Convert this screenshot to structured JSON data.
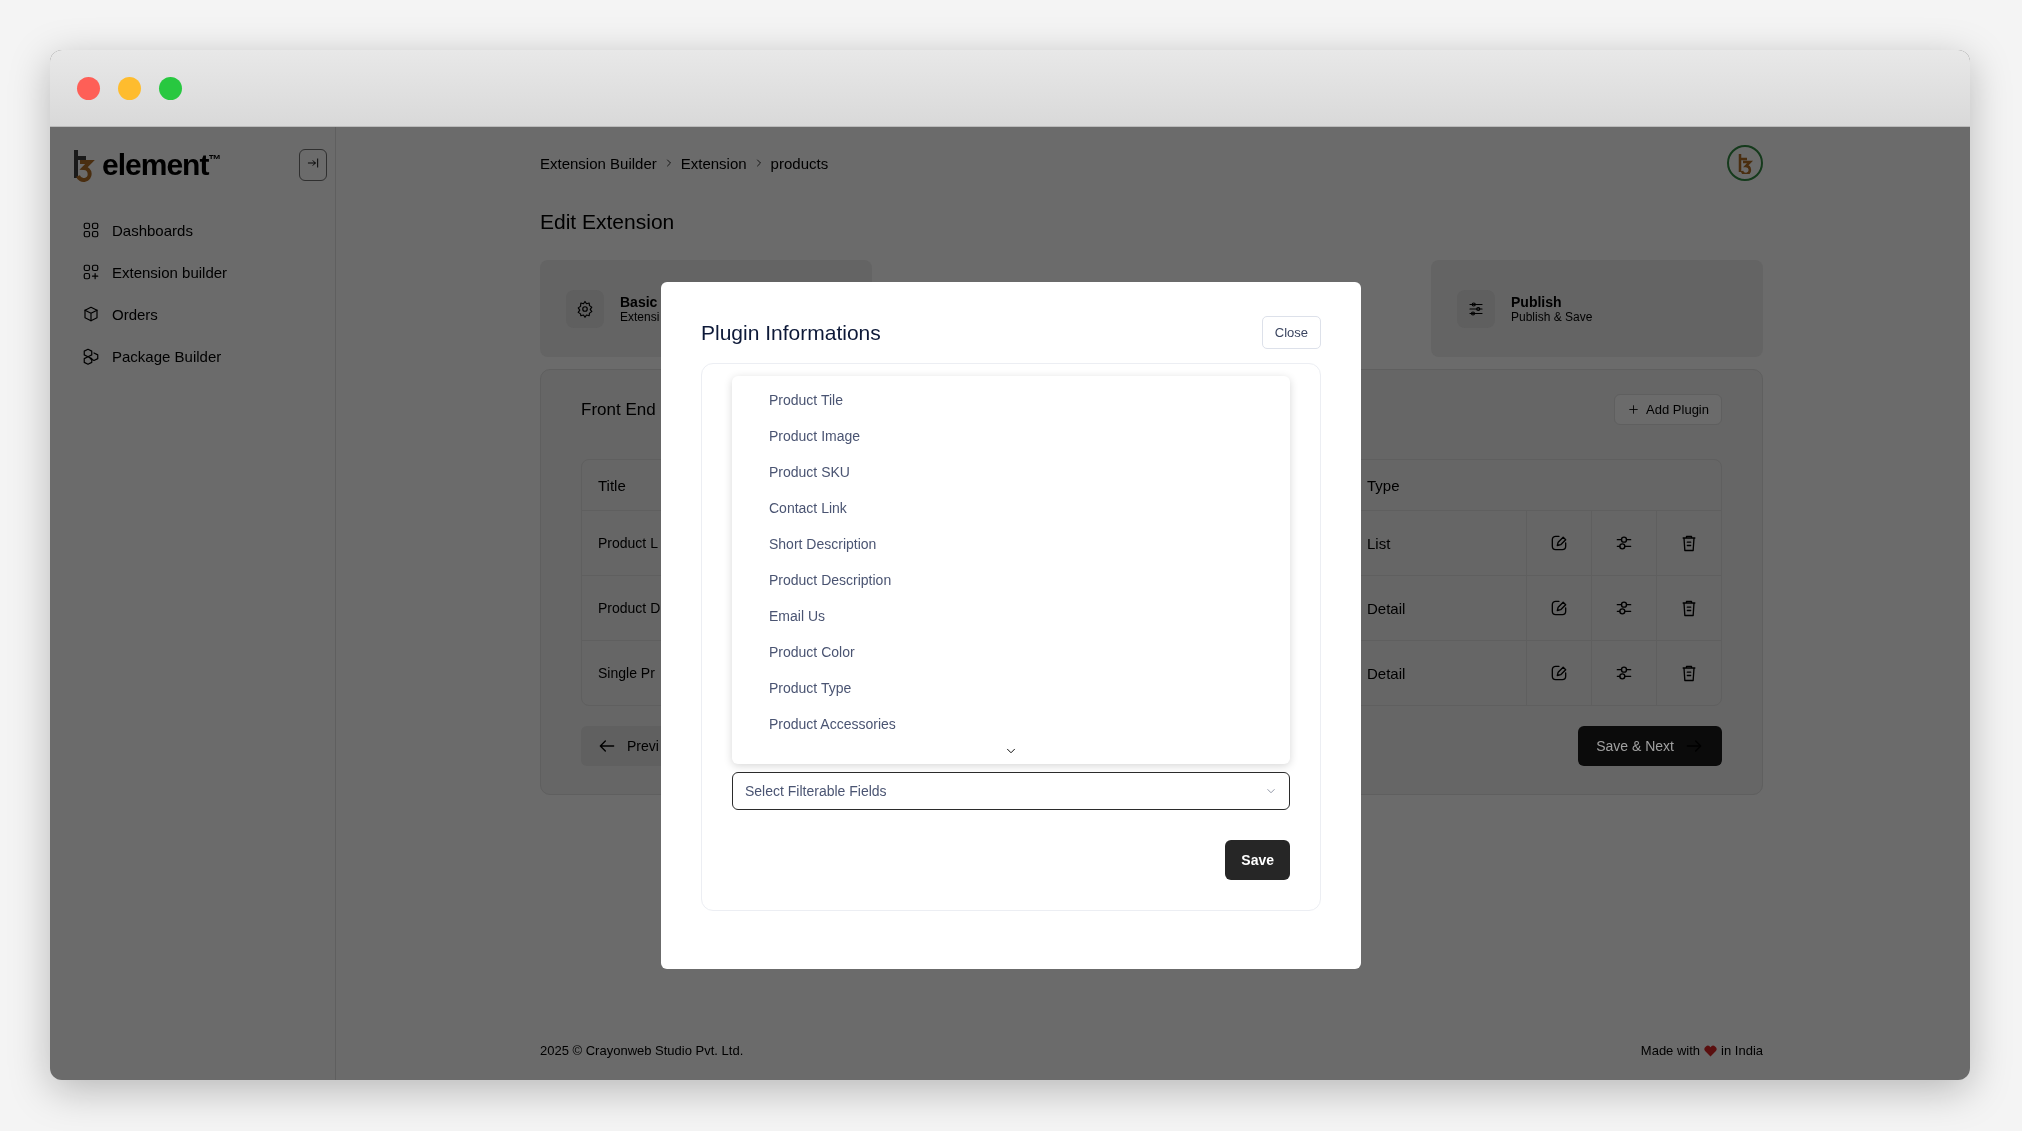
{
  "logo": {
    "text": "element",
    "mark": "™"
  },
  "sidebar": {
    "items": [
      {
        "label": "Dashboards"
      },
      {
        "label": "Extension builder"
      },
      {
        "label": "Orders"
      },
      {
        "label": "Package Builder"
      }
    ]
  },
  "breadcrumb": [
    "Extension Builder",
    "Extension",
    "products"
  ],
  "page_title": "Edit Extension",
  "steps": [
    {
      "title": "Basic",
      "subtitle": "Extensi"
    },
    {
      "title": "Publish",
      "subtitle": "Publish & Save"
    }
  ],
  "section": {
    "title": "Front End",
    "add_button": "Add Plugin"
  },
  "table": {
    "columns": [
      "Title",
      "Type"
    ],
    "rows": [
      {
        "title": "Product L",
        "type": "List"
      },
      {
        "title": "Product D",
        "type": "Detail"
      },
      {
        "title": "Single Pr",
        "type": "Detail"
      }
    ]
  },
  "nav": {
    "previous": "Previ",
    "next": "Save & Next"
  },
  "footer": {
    "copyright": "2025 ©  Crayonweb Studio Pvt. Ltd.",
    "made_with": "Made with",
    "in_india": "in India"
  },
  "modal": {
    "title": "Plugin Informations",
    "close": "Close",
    "options": [
      "Product Tile",
      "Product Image",
      "Product SKU",
      "Contact Link",
      "Short Description",
      "Product Description",
      "Email Us",
      "Product Color",
      "Product Type",
      "Product Accessories"
    ],
    "select": {
      "placeholder": "Select Filterable Fields"
    },
    "save": "Save"
  }
}
